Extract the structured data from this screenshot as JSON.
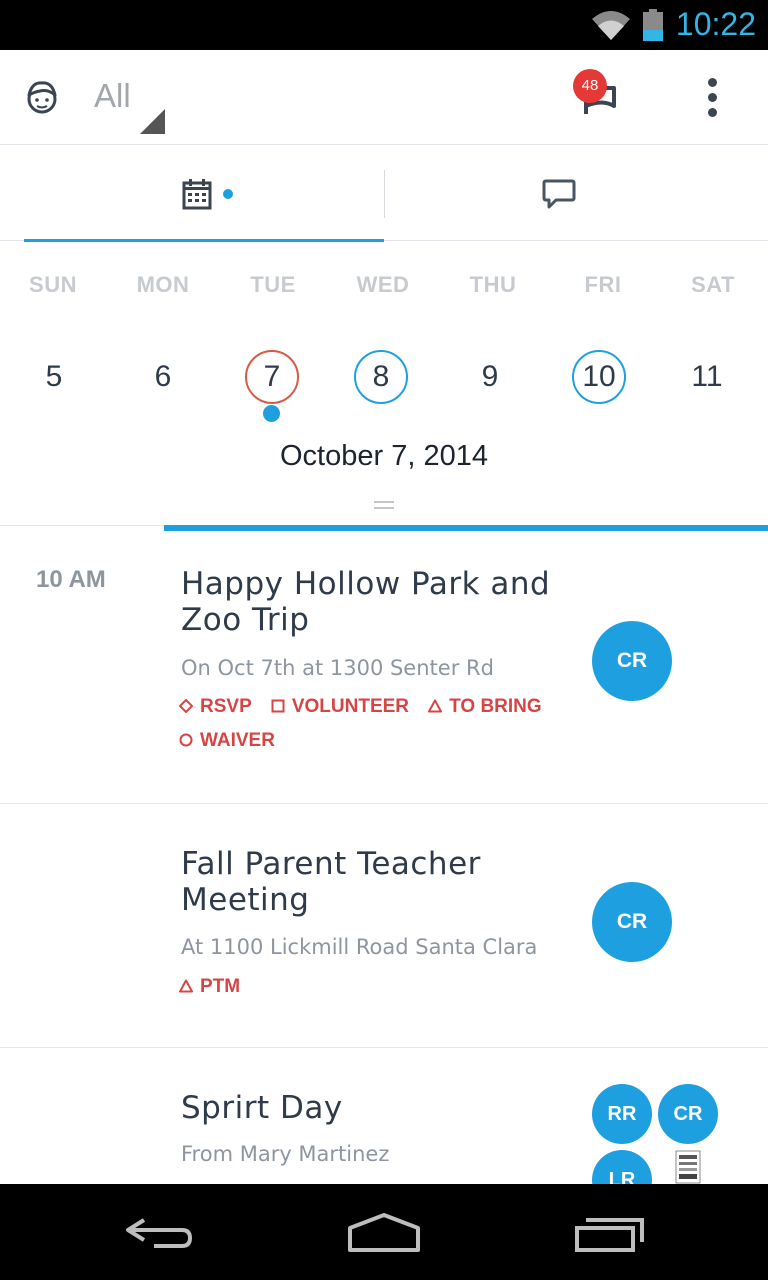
{
  "status_bar": {
    "time": "10:22",
    "wifi_icon": "wifi-icon",
    "battery_icon": "battery-icon"
  },
  "app_bar": {
    "filter_value": "All",
    "notification_count": "48",
    "icons": [
      "child-face-icon",
      "flag-icon",
      "more-vert-icon"
    ]
  },
  "tabs": [
    {
      "id": "calendar",
      "icon": "calendar-icon",
      "active": true
    },
    {
      "id": "messages",
      "icon": "chat-bubble-icon",
      "active": false
    }
  ],
  "week": {
    "weekdays": [
      "SUN",
      "MON",
      "TUE",
      "WED",
      "THU",
      "FRI",
      "SAT"
    ],
    "days": [
      {
        "num": "5",
        "ring": "none"
      },
      {
        "num": "6",
        "ring": "none"
      },
      {
        "num": "7",
        "ring": "red"
      },
      {
        "num": "8",
        "ring": "blue"
      },
      {
        "num": "9",
        "ring": "none"
      },
      {
        "num": "10",
        "ring": "blue"
      },
      {
        "num": "11",
        "ring": "none"
      }
    ],
    "selected_date": "October 7, 2014"
  },
  "colors": {
    "accent": "#1ea0e0",
    "alert": "#d64545",
    "today_ring": "#d65a45"
  },
  "events": [
    {
      "time": "10 AM",
      "title": "Happy Hollow Park and Zoo Trip",
      "subtitle": "On Oct 7th at 1300 Senter Rd",
      "tags": [
        {
          "icon": "diamond",
          "label": "RSVP"
        },
        {
          "icon": "square",
          "label": "VOLUNTEER"
        },
        {
          "icon": "triangle",
          "label": "TO BRING"
        },
        {
          "icon": "circle",
          "label": "WAIVER"
        }
      ],
      "avatars": [
        "CR"
      ]
    },
    {
      "time": "",
      "title": "Fall Parent Teacher Meeting",
      "subtitle": "At 1100 Lickmill Road Santa Clara",
      "tags": [
        {
          "icon": "triangle",
          "label": "PTM"
        }
      ],
      "avatars": [
        "CR"
      ]
    },
    {
      "time": "",
      "title": "Sprirt Day",
      "subtitle": "From Mary Martinez",
      "tags": [],
      "avatars": [
        "RR",
        "CR",
        "LR"
      ]
    }
  ],
  "nav_bar": {
    "icons": [
      "back-icon",
      "home-icon",
      "recents-icon"
    ]
  }
}
